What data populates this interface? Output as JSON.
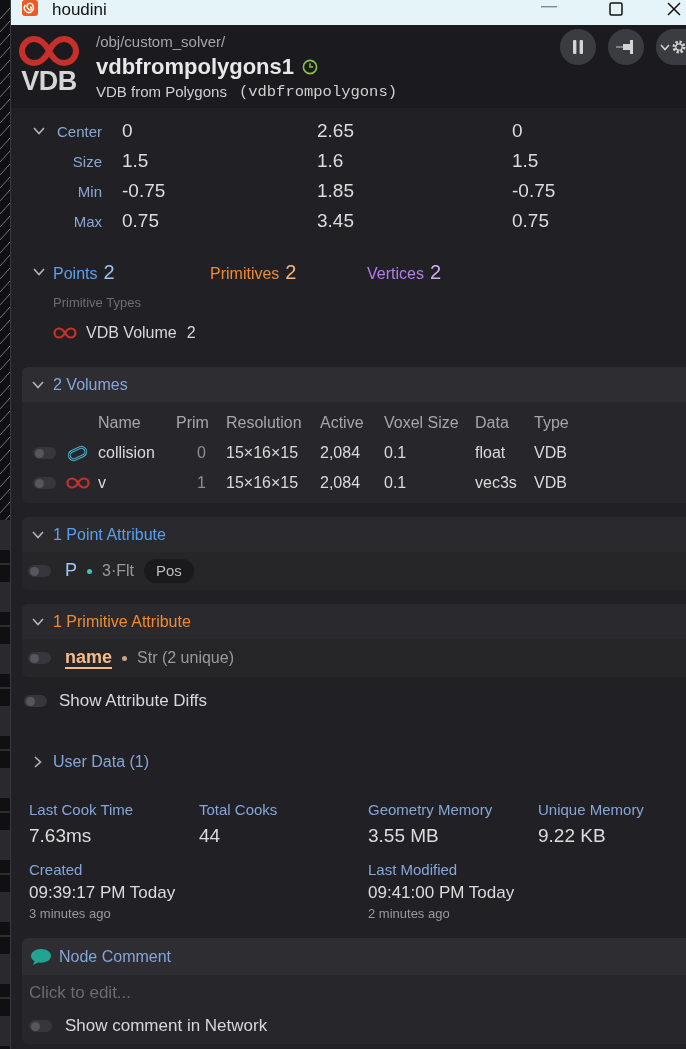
{
  "titlebar": {
    "title": "houdini"
  },
  "header": {
    "logo_text": "VDB",
    "path": "/obj/custom_solver/",
    "node_name": "vdbfrompolygons1",
    "type_label": "VDB from Polygons",
    "type_id": "(vdbfrompolygons)"
  },
  "bounds": {
    "expanded": true,
    "rows": [
      {
        "label": "Center",
        "values": [
          "0",
          "2.65",
          "0"
        ]
      },
      {
        "label": "Size",
        "values": [
          "1.5",
          "1.6",
          "1.5"
        ]
      },
      {
        "label": "Min",
        "values": [
          "-0.75",
          "1.85",
          "-0.75"
        ]
      },
      {
        "label": "Max",
        "values": [
          "0.75",
          "3.45",
          "0.75"
        ]
      }
    ]
  },
  "counts": {
    "expanded": true,
    "items": [
      {
        "label": "Points",
        "value": "2",
        "color": "#5e9fea"
      },
      {
        "label": "Primitives",
        "value": "2",
        "color": "#ee8a35"
      },
      {
        "label": "Vertices",
        "value": "2",
        "color": "#b47cf0"
      }
    ],
    "primitive_types": {
      "heading": "Primitive Types",
      "items": [
        {
          "label": "VDB Volume",
          "count": "2"
        }
      ]
    }
  },
  "volumes": {
    "title": "2 Volumes",
    "expanded": true,
    "columns": [
      "Name",
      "Prim",
      "Resolution",
      "Active",
      "Voxel Size",
      "Data",
      "Type"
    ],
    "rows": [
      {
        "on": false,
        "kind": "sdf",
        "cells": [
          "collision",
          "0",
          "15×16×15",
          "2,084",
          "0.1",
          "float",
          "VDB"
        ]
      },
      {
        "on": false,
        "kind": "vector",
        "cells": [
          "v",
          "1",
          "15×16×15",
          "2,084",
          "0.1",
          "vec3s",
          "VDB"
        ]
      }
    ]
  },
  "attribute_groups": [
    {
      "title": "1 Point Attribute",
      "expanded": true,
      "color": "#5b9ef0",
      "items": [
        {
          "on": false,
          "selected": false,
          "name": "P",
          "color": "#3cc6b2",
          "type": "3·Flt",
          "tag": "Pos"
        }
      ]
    },
    {
      "title": "1 Primitive Attribute",
      "expanded": true,
      "color": "#ee8a35",
      "items": [
        {
          "on": false,
          "selected": true,
          "name": "name",
          "color": "#c9a184",
          "type": "Str (2 unique)"
        }
      ]
    }
  ],
  "show_attribute_diffs": {
    "label": "Show Attribute Diffs",
    "on": false
  },
  "user_data": {
    "title": "User Data (1)",
    "expanded": false
  },
  "stats": [
    {
      "label": "Last Cook Time",
      "value": "7.63ms"
    },
    {
      "label": "Total Cooks",
      "value": "44"
    },
    {
      "label": "Geometry Memory",
      "value": "3.55 MB"
    },
    {
      "label": "Unique Memory",
      "value": "9.22 KB"
    }
  ],
  "timestamps": [
    {
      "label": "Created",
      "value": "09:39:17 PM Today",
      "ago": "3 minutes ago"
    },
    {
      "label": "Last Modified",
      "value": "09:41:00 PM Today",
      "ago": "2 minutes ago"
    }
  ],
  "node_comment": {
    "title": "Node Comment",
    "placeholder": "Click to edit...",
    "show_in_network": {
      "label": "Show comment in Network",
      "on": false
    }
  }
}
